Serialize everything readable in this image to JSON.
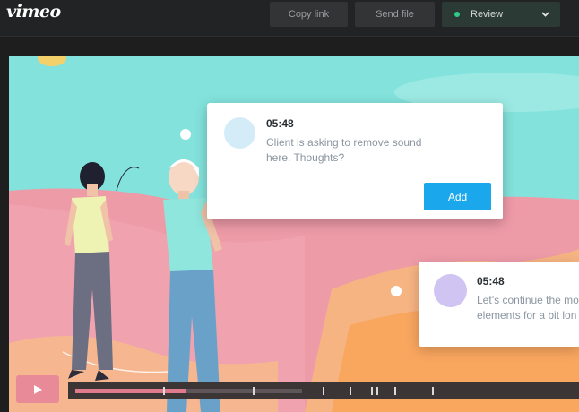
{
  "header": {
    "logo": "vimeo",
    "copy_link_label": "Copy link",
    "send_file_label": "Send file",
    "review_label": "Review",
    "review_status_color": "#2ecc87"
  },
  "comments": [
    {
      "time": "05:48",
      "text": "Client is asking to remove sound here. Thoughts?",
      "add_label": "Add",
      "avatar_color": "#d3ecf8"
    },
    {
      "time": "05:48",
      "text_line1": "Let’s continue the mo",
      "text_line2": "elements for a bit lon",
      "avatar_color": "#d0c4f3"
    }
  ],
  "player": {
    "play_icon": "play-icon",
    "progress_fraction": 0.22,
    "buffered_fraction": 0.45,
    "accent_color": "#e07b8d"
  }
}
